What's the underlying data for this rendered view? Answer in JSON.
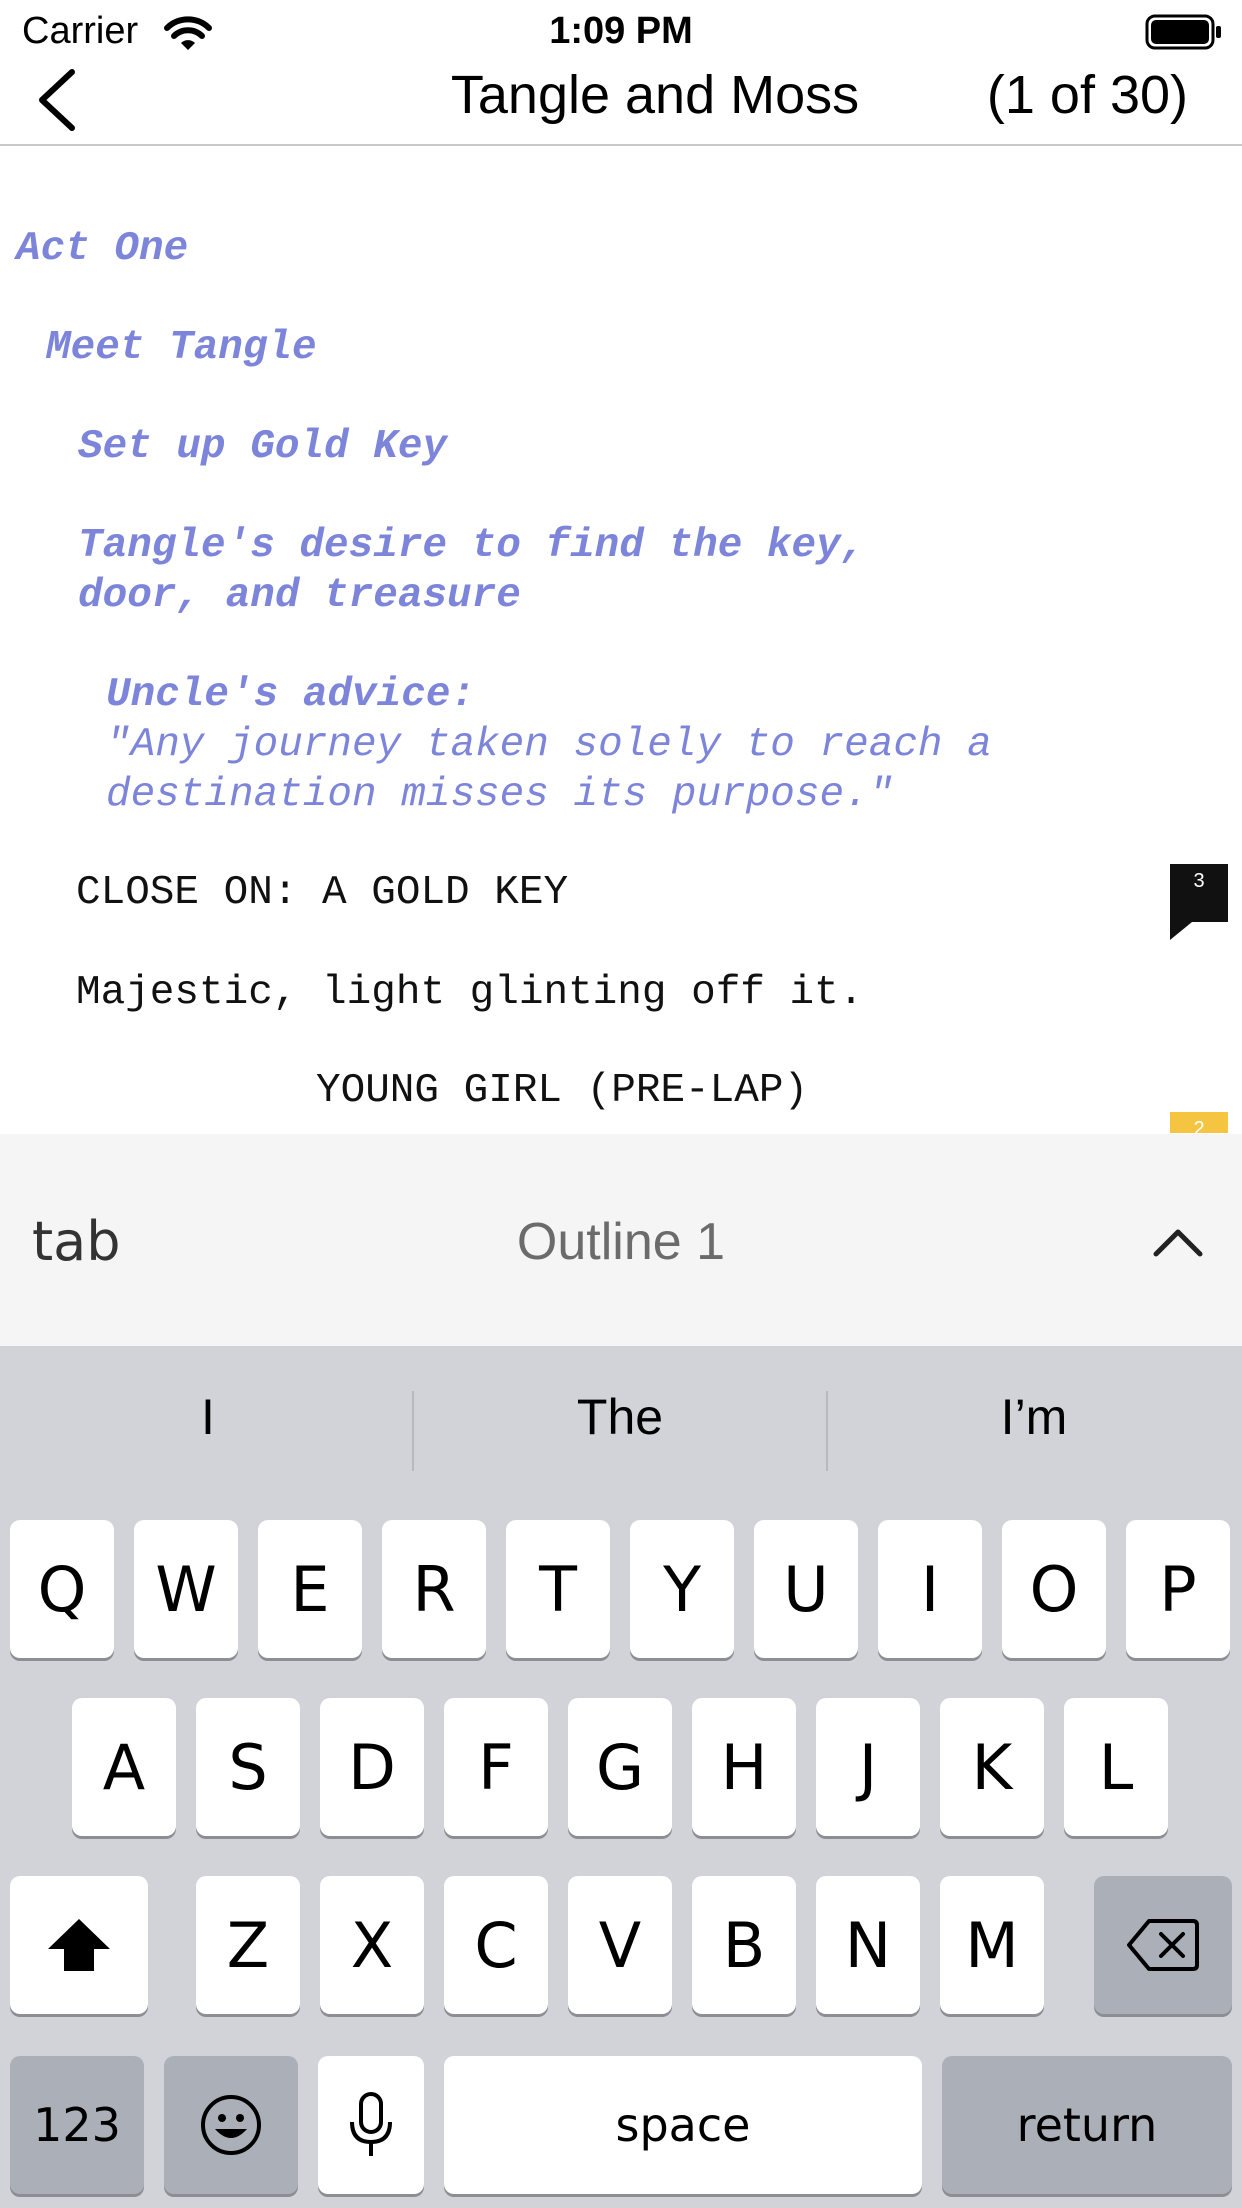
{
  "status_bar": {
    "carrier": "Carrier",
    "time": "1:09 PM"
  },
  "nav": {
    "title": "Tangle and Moss",
    "page_count": "(1 of 30)"
  },
  "script": {
    "outline": [
      "Act One",
      "Meet Tangle",
      "Set up Gold Key",
      "Tangle's desire to find the key,",
      "door, and treasure",
      "Uncle's advice:"
    ],
    "quote": [
      "\"Any journey taken solely to reach a",
      "destination misses its purpose.\""
    ],
    "action": [
      "CLOSE ON: A GOLD KEY",
      "Majestic, light glinting off it.",
      "YOUNG GIRL (PRE-LAP)"
    ],
    "note_badges": [
      "3",
      "2"
    ]
  },
  "toolbar": {
    "tab_label": "tab",
    "element_type": "Outline 1"
  },
  "keyboard": {
    "suggestions": [
      "I",
      "The",
      "I’m"
    ],
    "row1": [
      "Q",
      "W",
      "E",
      "R",
      "T",
      "Y",
      "U",
      "I",
      "O",
      "P"
    ],
    "row2": [
      "A",
      "S",
      "D",
      "F",
      "G",
      "H",
      "J",
      "K",
      "L"
    ],
    "row3": [
      "Z",
      "X",
      "C",
      "V",
      "B",
      "N",
      "M"
    ],
    "numbers_label": "123",
    "space_label": "space",
    "return_label": "return"
  },
  "colors": {
    "outline_text": "#7d85db",
    "keyboard_bg": "#d1d3d9",
    "function_key": "#abafb8",
    "toolbar_bg": "#f5f5f5"
  }
}
